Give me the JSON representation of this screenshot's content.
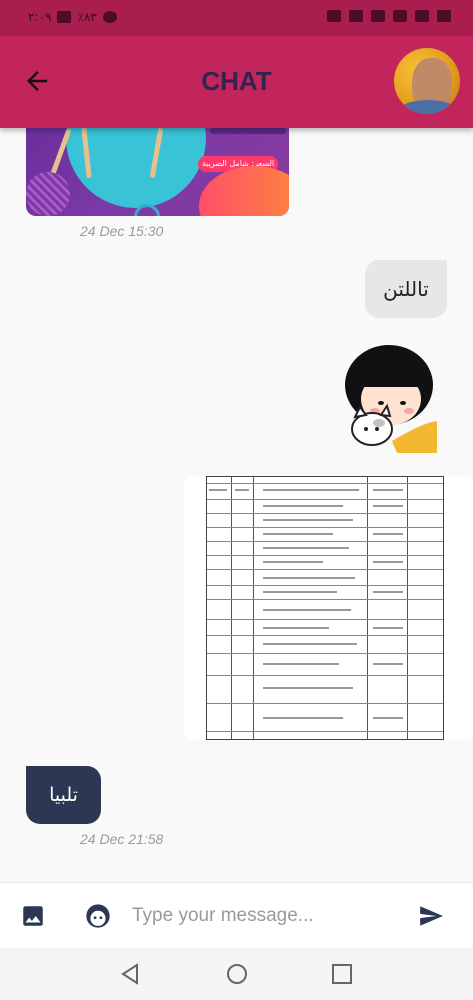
{
  "status_bar": {
    "time": "٢:٠٩",
    "battery": "٪٨٣"
  },
  "header": {
    "title": "CHAT"
  },
  "messages": [
    {
      "type": "image",
      "side": "left",
      "caption_tag": "السعر: شامل الضريبة",
      "time": "24 Dec 15:30"
    },
    {
      "type": "text",
      "side": "right",
      "text": "تاللتن"
    },
    {
      "type": "sticker",
      "side": "right",
      "sticker": "girl-with-cat"
    },
    {
      "type": "image",
      "side": "right",
      "image": "schedule-table"
    },
    {
      "type": "text",
      "side": "left",
      "text": "تلبيا",
      "time": "24 Dec 21:58"
    }
  ],
  "composer": {
    "placeholder": "Type your message..."
  },
  "colors": {
    "status_bar": "#a91d4f",
    "app_bar": "#c2255c",
    "title": "#33234d",
    "left_bubble": "#2b3753",
    "right_bubble": "#e7e7e7"
  }
}
